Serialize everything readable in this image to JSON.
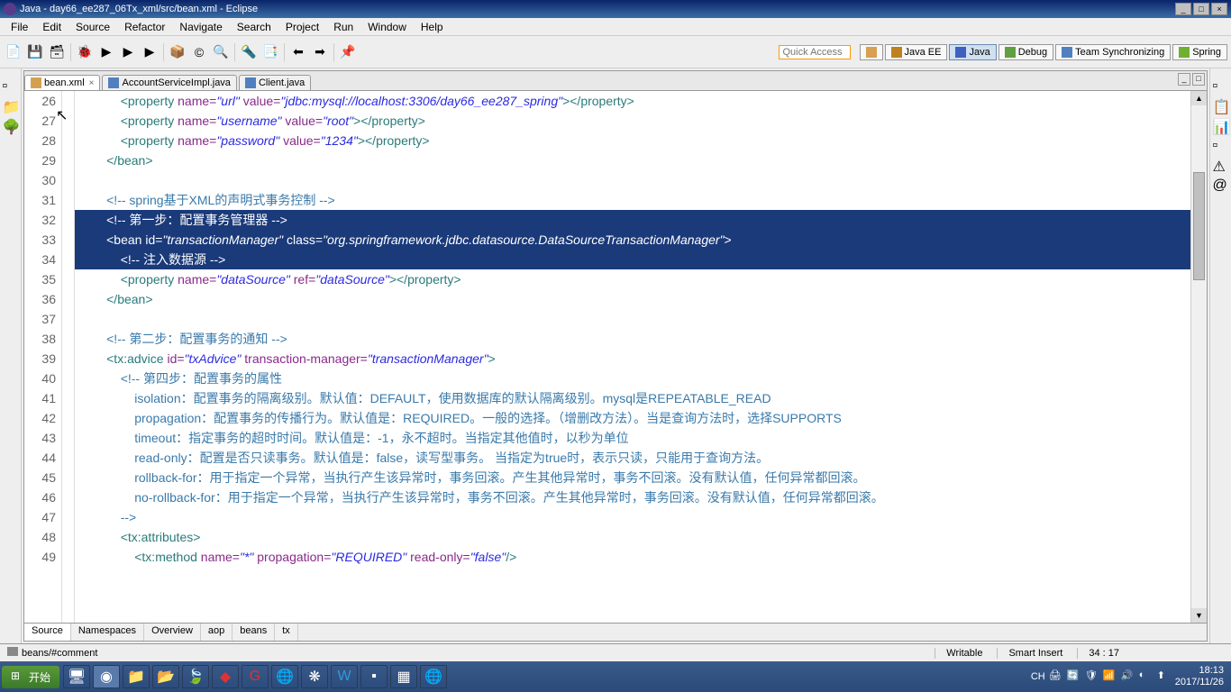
{
  "window": {
    "title": "Java - day66_ee287_06Tx_xml/src/bean.xml - Eclipse"
  },
  "menu": {
    "items": [
      "File",
      "Edit",
      "Source",
      "Refactor",
      "Navigate",
      "Search",
      "Project",
      "Run",
      "Window",
      "Help"
    ]
  },
  "quick_access": {
    "placeholder": "Quick Access"
  },
  "perspectives": [
    {
      "label": "Java EE",
      "active": false
    },
    {
      "label": "Java",
      "active": true
    },
    {
      "label": "Debug",
      "active": false
    },
    {
      "label": "Team Synchronizing",
      "active": false
    },
    {
      "label": "Spring",
      "active": false
    }
  ],
  "editor": {
    "tabs": [
      {
        "label": "bean.xml",
        "active": true,
        "type": "xml"
      },
      {
        "label": "AccountServiceImpl.java",
        "active": false,
        "type": "java"
      },
      {
        "label": "Client.java",
        "active": false,
        "type": "java"
      }
    ],
    "bottom_tabs": [
      "Source",
      "Namespaces",
      "Overview",
      "aop",
      "beans",
      "tx"
    ],
    "active_bottom_tab": "Source"
  },
  "code": {
    "first_line": 26,
    "lines": [
      {
        "n": 26,
        "indent": 12,
        "segs": [
          {
            "t": "<property ",
            "c": "tag"
          },
          {
            "t": "name=",
            "c": "attr"
          },
          {
            "t": "\"url\"",
            "c": "str"
          },
          {
            "t": " value=",
            "c": "attr"
          },
          {
            "t": "\"jdbc:mysql://localhost:3306/day66_ee287_spring\"",
            "c": "str"
          },
          {
            "t": "></property>",
            "c": "tag"
          }
        ]
      },
      {
        "n": 27,
        "indent": 12,
        "segs": [
          {
            "t": "<property ",
            "c": "tag"
          },
          {
            "t": "name=",
            "c": "attr"
          },
          {
            "t": "\"username\"",
            "c": "str"
          },
          {
            "t": " value=",
            "c": "attr"
          },
          {
            "t": "\"root\"",
            "c": "str"
          },
          {
            "t": "></property>",
            "c": "tag"
          }
        ]
      },
      {
        "n": 28,
        "indent": 12,
        "segs": [
          {
            "t": "<property ",
            "c": "tag"
          },
          {
            "t": "name=",
            "c": "attr"
          },
          {
            "t": "\"password\"",
            "c": "str"
          },
          {
            "t": " value=",
            "c": "attr"
          },
          {
            "t": "\"1234\"",
            "c": "str"
          },
          {
            "t": "></property>",
            "c": "tag"
          }
        ]
      },
      {
        "n": 29,
        "indent": 8,
        "segs": [
          {
            "t": "</bean>",
            "c": "tag"
          }
        ]
      },
      {
        "n": 30,
        "indent": 0,
        "segs": []
      },
      {
        "n": 31,
        "indent": 8,
        "segs": [
          {
            "t": "<!-- spring基于XML的声明式事务控制 -->",
            "c": "cmt"
          }
        ]
      },
      {
        "n": 32,
        "indent": 8,
        "sel": true,
        "segs": [
          {
            "t": "<!-- 第一步：配置事务管理器 -->",
            "c": "cmt"
          }
        ]
      },
      {
        "n": 33,
        "indent": 8,
        "sel": true,
        "segs": [
          {
            "t": "<bean ",
            "c": "tag"
          },
          {
            "t": "id=",
            "c": "attr"
          },
          {
            "t": "\"transactionManager\"",
            "c": "str"
          },
          {
            "t": " class=",
            "c": "attr"
          },
          {
            "t": "\"org.springframework.jdbc.datasource.DataSourceTransactionManager\"",
            "c": "str"
          },
          {
            "t": ">",
            "c": "tag"
          }
        ]
      },
      {
        "n": 34,
        "indent": 12,
        "sel": true,
        "segs": [
          {
            "t": "<!-- 注入数据源 -->",
            "c": "cmt"
          }
        ]
      },
      {
        "n": 35,
        "indent": 12,
        "segs": [
          {
            "t": "<property ",
            "c": "tag"
          },
          {
            "t": "name=",
            "c": "attr"
          },
          {
            "t": "\"dataSource\"",
            "c": "str"
          },
          {
            "t": " ref=",
            "c": "attr"
          },
          {
            "t": "\"dataSource\"",
            "c": "str"
          },
          {
            "t": "></property>",
            "c": "tag"
          }
        ]
      },
      {
        "n": 36,
        "indent": 8,
        "segs": [
          {
            "t": "</bean>",
            "c": "tag"
          }
        ]
      },
      {
        "n": 37,
        "indent": 0,
        "segs": []
      },
      {
        "n": 38,
        "indent": 8,
        "segs": [
          {
            "t": "<!-- 第二步：配置事务的通知 -->",
            "c": "cmt"
          }
        ]
      },
      {
        "n": 39,
        "indent": 8,
        "segs": [
          {
            "t": "<tx:advice ",
            "c": "tag"
          },
          {
            "t": "id=",
            "c": "attr"
          },
          {
            "t": "\"txAdvice\"",
            "c": "str"
          },
          {
            "t": " transaction-manager=",
            "c": "attr"
          },
          {
            "t": "\"transactionManager\"",
            "c": "str"
          },
          {
            "t": ">",
            "c": "tag"
          }
        ]
      },
      {
        "n": 40,
        "indent": 12,
        "segs": [
          {
            "t": "<!-- 第四步：配置事务的属性",
            "c": "cmt"
          }
        ]
      },
      {
        "n": 41,
        "indent": 16,
        "segs": [
          {
            "t": "isolation：配置事务的隔离级别。默认值：DEFAULT，使用数据库的默认隔离级别。mysql是REPEATABLE_READ",
            "c": "cmt-hl"
          }
        ]
      },
      {
        "n": 42,
        "indent": 16,
        "segs": [
          {
            "t": "propagation：配置事务的传播行为。默认值是：REQUIRED。一般的选择。（增删改方法）。当是查询方法时，选择SUPPORTS",
            "c": "cmt-hl"
          }
        ]
      },
      {
        "n": 43,
        "indent": 16,
        "segs": [
          {
            "t": "timeout：指定事务的超时时间。默认值是：-1，永不超时。当指定其他值时，以秒为单位",
            "c": "cmt-hl"
          }
        ]
      },
      {
        "n": 44,
        "indent": 16,
        "segs": [
          {
            "t": "read-only：配置是否只读事务。默认值是：false，读写型事务。 当指定为true时，表示只读，只能用于查询方法。",
            "c": "cmt-hl"
          }
        ]
      },
      {
        "n": 45,
        "indent": 16,
        "segs": [
          {
            "t": "rollback-for：用于指定一个异常，当执行产生该异常时，事务回滚。产生其他异常时，事务不回滚。没有默认值，任何异常都回滚。",
            "c": "cmt-hl"
          }
        ]
      },
      {
        "n": 46,
        "indent": 16,
        "segs": [
          {
            "t": "no-rollback-for：用于指定一个异常，当执行产生该异常时，事务不回滚。产生其他异常时，事务回滚。没有默认值，任何异常都回滚。",
            "c": "cmt-hl"
          }
        ]
      },
      {
        "n": 47,
        "indent": 12,
        "segs": [
          {
            "t": "-->",
            "c": "cmt"
          }
        ]
      },
      {
        "n": 48,
        "indent": 12,
        "segs": [
          {
            "t": "<tx:attributes>",
            "c": "tag"
          }
        ]
      },
      {
        "n": 49,
        "indent": 16,
        "segs": [
          {
            "t": "<tx:method ",
            "c": "tag"
          },
          {
            "t": "name=",
            "c": "attr"
          },
          {
            "t": "\"*\"",
            "c": "str"
          },
          {
            "t": " propagation=",
            "c": "attr"
          },
          {
            "t": "\"REQUIRED\"",
            "c": "str"
          },
          {
            "t": " read-only=",
            "c": "attr"
          },
          {
            "t": "\"false\"",
            "c": "str"
          },
          {
            "t": "/>",
            "c": "tag"
          }
        ]
      }
    ]
  },
  "status": {
    "breadcrumb": "beans/#comment",
    "writable": "Writable",
    "insert": "Smart Insert",
    "position": "34 : 17"
  },
  "taskbar": {
    "start": "开始",
    "ime": "CH",
    "time": "18:13",
    "date": "2017/11/26"
  }
}
